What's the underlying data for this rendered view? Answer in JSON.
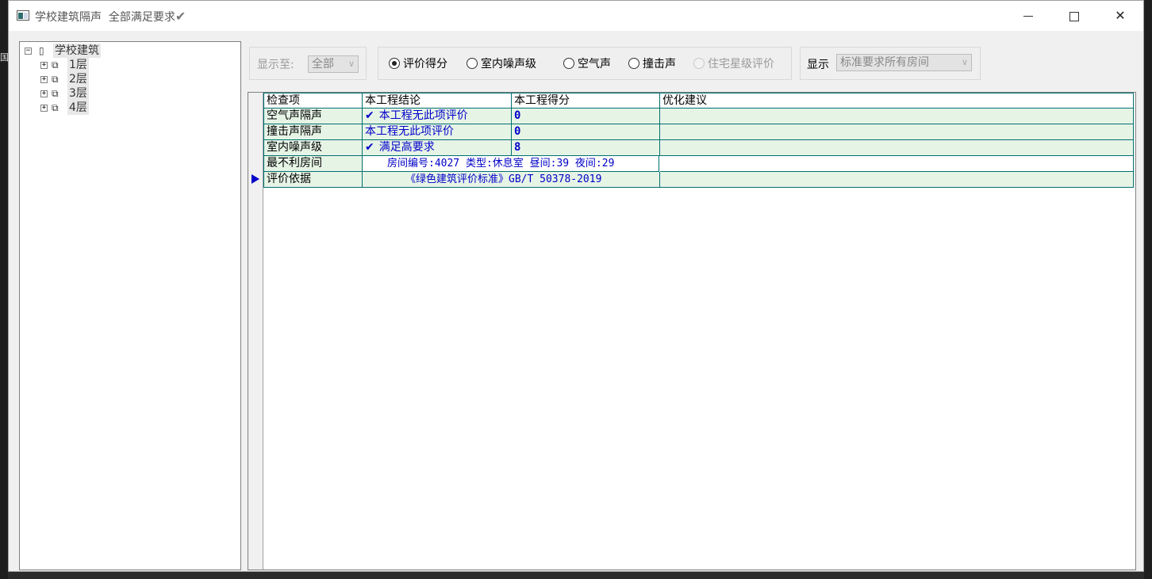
{
  "window": {
    "title": "学校建筑隔声",
    "status": "全部满足要求",
    "status_icon": "check-icon"
  },
  "tree": {
    "root": {
      "label": "学校建筑",
      "expander": "−"
    },
    "children": [
      {
        "label": "1层",
        "expander": "+"
      },
      {
        "label": "2层",
        "expander": "+"
      },
      {
        "label": "3层",
        "expander": "+"
      },
      {
        "label": "4层",
        "expander": "+"
      }
    ]
  },
  "toolbar": {
    "display_to_label": "显示至:",
    "display_to_value": "全部",
    "modes": [
      {
        "label": "评价得分",
        "selected": true,
        "enabled": true
      },
      {
        "label": "室内噪声级",
        "selected": false,
        "enabled": true
      },
      {
        "label": "空气声",
        "selected": false,
        "enabled": true
      },
      {
        "label": "撞击声",
        "selected": false,
        "enabled": true
      },
      {
        "label": "住宅星级评价",
        "selected": false,
        "enabled": false
      }
    ],
    "show_label": "显示",
    "show_value": "标准要求所有房间"
  },
  "grid": {
    "headers": [
      "检查项",
      "本工程结论",
      "本工程得分",
      "优化建议"
    ],
    "rows": [
      {
        "item": "空气声隔声",
        "conclusion": "本工程无此项评价",
        "check": true,
        "score": "0",
        "advice": ""
      },
      {
        "item": "撞击声隔声",
        "conclusion": "本工程无此项评价",
        "check": false,
        "score": "0",
        "advice": ""
      },
      {
        "item": "室内噪声级",
        "conclusion": "满足高要求",
        "check": true,
        "score": "8",
        "advice": ""
      },
      {
        "item": "最不利房间",
        "conclusion": "房间编号:4027 类型:休息室 昼间:39 夜间:29",
        "check": false,
        "score": "",
        "advice": ""
      },
      {
        "item": "评价依据",
        "conclusion": "《绿色建筑评价标准》GB/T 50378-2019",
        "check": false,
        "score": "",
        "advice": ""
      }
    ],
    "current_row_index": 4
  },
  "colors": {
    "grid_line": "#007070",
    "row_green": "#e6f4e6",
    "value_blue": "#0000c8"
  }
}
